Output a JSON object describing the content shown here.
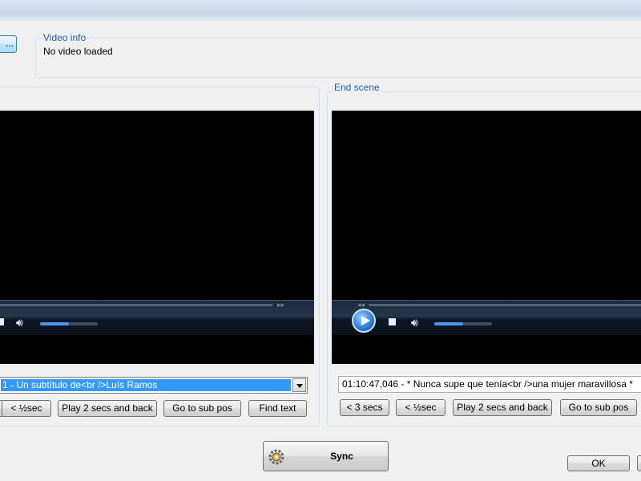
{
  "toolbar": {
    "browse_button_label": "..."
  },
  "video_info": {
    "group_label": "Video info",
    "status_text": "No video loaded"
  },
  "start_scene": {
    "subtitle_selected": "1 - Un subtítulo de<br />Luís Ramos",
    "buttons": {
      "half_sec_back": "< ½sec",
      "play_2_secs_back": "Play 2 secs and back",
      "go_to_sub_pos": "Go to sub pos",
      "find_text": "Find text"
    }
  },
  "end_scene": {
    "group_label": "End scene",
    "subtitle_text": "01:10:47,046 - * Nunca supe que tenía<br />una mujer maravillosa *",
    "buttons": {
      "three_secs_back": "< 3 secs",
      "half_sec_back": "< ½sec",
      "play_2_secs_back": "Play 2 secs and back",
      "go_to_sub_pos": "Go to sub pos"
    }
  },
  "footer": {
    "sync_label": "Sync",
    "ok_label": "OK"
  },
  "icons": {
    "play": "play-icon",
    "stop": "stop-icon",
    "volume": "volume-icon",
    "sync": "gear-sync-icon",
    "dropdown": "chevron-down-icon"
  },
  "colors": {
    "group_label": "#1f5fa8",
    "selection": "#3399ff",
    "video_bg": "#000000",
    "volume_fill": "#4a95f0"
  }
}
